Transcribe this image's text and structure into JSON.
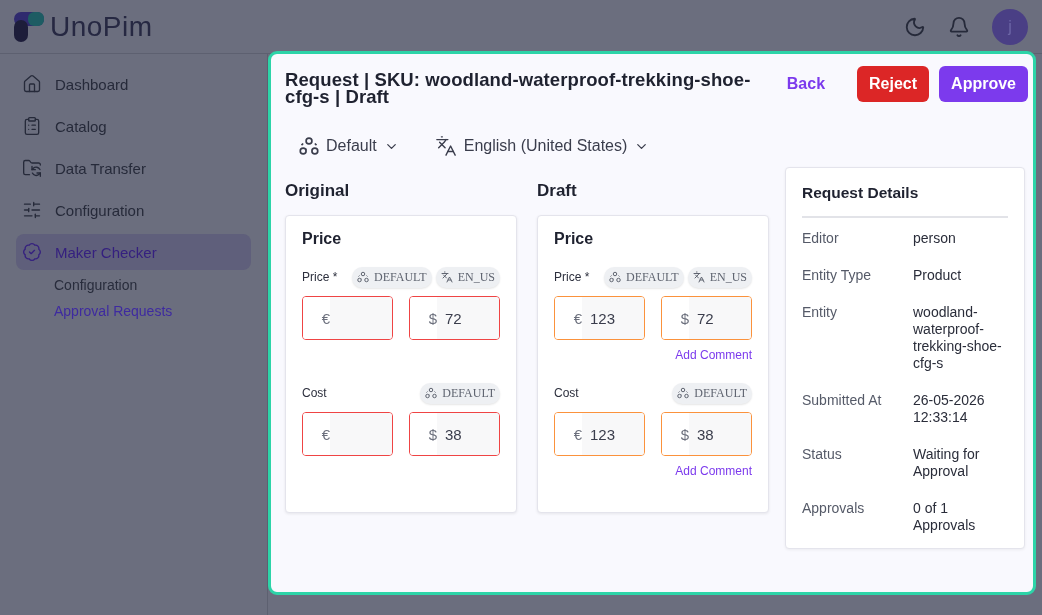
{
  "app": {
    "logo_text": "UnoPim",
    "avatar": "j"
  },
  "sidebar": {
    "items": [
      {
        "label": "Dashboard",
        "kind": "home",
        "selected": false
      },
      {
        "label": "Catalog",
        "kind": "catalog",
        "selected": false
      },
      {
        "label": "Data Transfer",
        "kind": "transfer",
        "selected": false
      },
      {
        "label": "Configuration",
        "kind": "config",
        "selected": false
      },
      {
        "label": "Maker Checker",
        "kind": "checker",
        "selected": true,
        "children": [
          {
            "label": "Configuration",
            "selected": false
          },
          {
            "label": "Approval Requests",
            "selected": true
          }
        ]
      }
    ]
  },
  "page": {
    "title": "Request | SKU: woodland-waterproof-trekking-shoe-cfg-s | Draft",
    "buttons": [
      {
        "label": "Back",
        "kind": "link"
      },
      {
        "label": "Reject",
        "kind": "danger"
      },
      {
        "label": "Approve",
        "kind": "primary"
      }
    ],
    "channel": "Default",
    "locale": "English (United States)"
  },
  "columns": [
    {
      "title": "Original",
      "kind": "original",
      "card_title": "Price",
      "attributes": [
        {
          "label": "Price *",
          "tags": [
            {
              "kind": "channel",
              "text": "DEFAULT"
            },
            {
              "kind": "locale",
              "text": "EN_US"
            }
          ],
          "inputs": [
            {
              "currency": "€"
            },
            {
              "currency": "$",
              "value": "72"
            }
          ]
        },
        {
          "label": "Cost",
          "tags": [
            {
              "kind": "channel",
              "text": "DEFAULT"
            }
          ],
          "inputs": [
            {
              "currency": "€"
            },
            {
              "currency": "$",
              "value": "38"
            }
          ]
        }
      ]
    },
    {
      "title": "Draft",
      "kind": "draft",
      "card_title": "Price",
      "attributes": [
        {
          "label": "Price *",
          "tags": [
            {
              "kind": "channel",
              "text": "DEFAULT"
            },
            {
              "kind": "locale",
              "text": "EN_US"
            }
          ],
          "inputs": [
            {
              "currency": "€",
              "value": "123"
            },
            {
              "currency": "$",
              "value": "72"
            }
          ],
          "comment_link": "Add Comment"
        },
        {
          "label": "Cost",
          "tags": [
            {
              "kind": "channel",
              "text": "DEFAULT"
            }
          ],
          "inputs": [
            {
              "currency": "€",
              "value": "123"
            },
            {
              "currency": "$",
              "value": "38"
            }
          ],
          "comment_link": "Add Comment"
        }
      ]
    }
  ],
  "details": {
    "title": "Request Details",
    "rows": [
      {
        "label": "Editor",
        "value": "person"
      },
      {
        "label": "Entity Type",
        "value": "Product"
      },
      {
        "label": "Entity",
        "value": "woodland-waterproof-trekking-shoe-cfg-s"
      },
      {
        "label": "Submitted At",
        "value": "26-05-2026 12:33:14"
      },
      {
        "label": "Status",
        "value": "Waiting for Approval"
      },
      {
        "label": "Approvals",
        "value": "0 of 1 Approvals"
      }
    ]
  }
}
